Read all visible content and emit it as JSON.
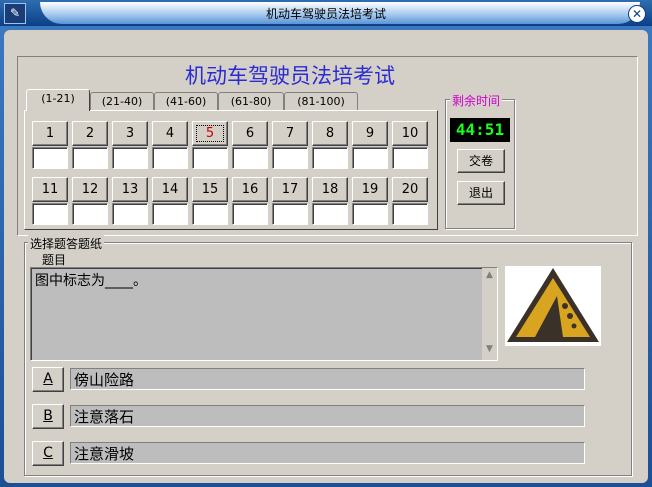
{
  "window": {
    "title": "机动车驾驶员法培考试"
  },
  "header": {
    "exam_title": "机动车驾驶员法培考试"
  },
  "tabs": [
    {
      "label": "(1-21)",
      "active": true
    },
    {
      "label": "(21-40)",
      "active": false
    },
    {
      "label": "(41-60)",
      "active": false
    },
    {
      "label": "(61-80)",
      "active": false
    },
    {
      "label": "(81-100)",
      "active": false
    }
  ],
  "questions": {
    "row1": [
      "1",
      "2",
      "3",
      "4",
      "5",
      "6",
      "7",
      "8",
      "9",
      "10"
    ],
    "row2": [
      "11",
      "12",
      "13",
      "14",
      "15",
      "16",
      "17",
      "18",
      "19",
      "20"
    ],
    "current": "5"
  },
  "timer": {
    "label": "剩余时间",
    "value": "44:51"
  },
  "actions": {
    "submit_label": "交卷",
    "exit_label": "退出"
  },
  "answer_sheet": {
    "group_label": "选择题答题纸",
    "question_label": "题目",
    "question_text": "图中标志为____。",
    "sign_icon": "falling-rocks-warning-sign",
    "options": [
      {
        "letter": "A",
        "text": "傍山险路"
      },
      {
        "letter": "B",
        "text": "注意落石"
      },
      {
        "letter": "C",
        "text": "注意滑坡"
      }
    ]
  },
  "colors": {
    "title_text": "#2b2bd4",
    "timer_text": "#1aff1a",
    "timer_bg": "#000000",
    "current_question": "#cc0000",
    "timer_label": "#cc00cc"
  }
}
